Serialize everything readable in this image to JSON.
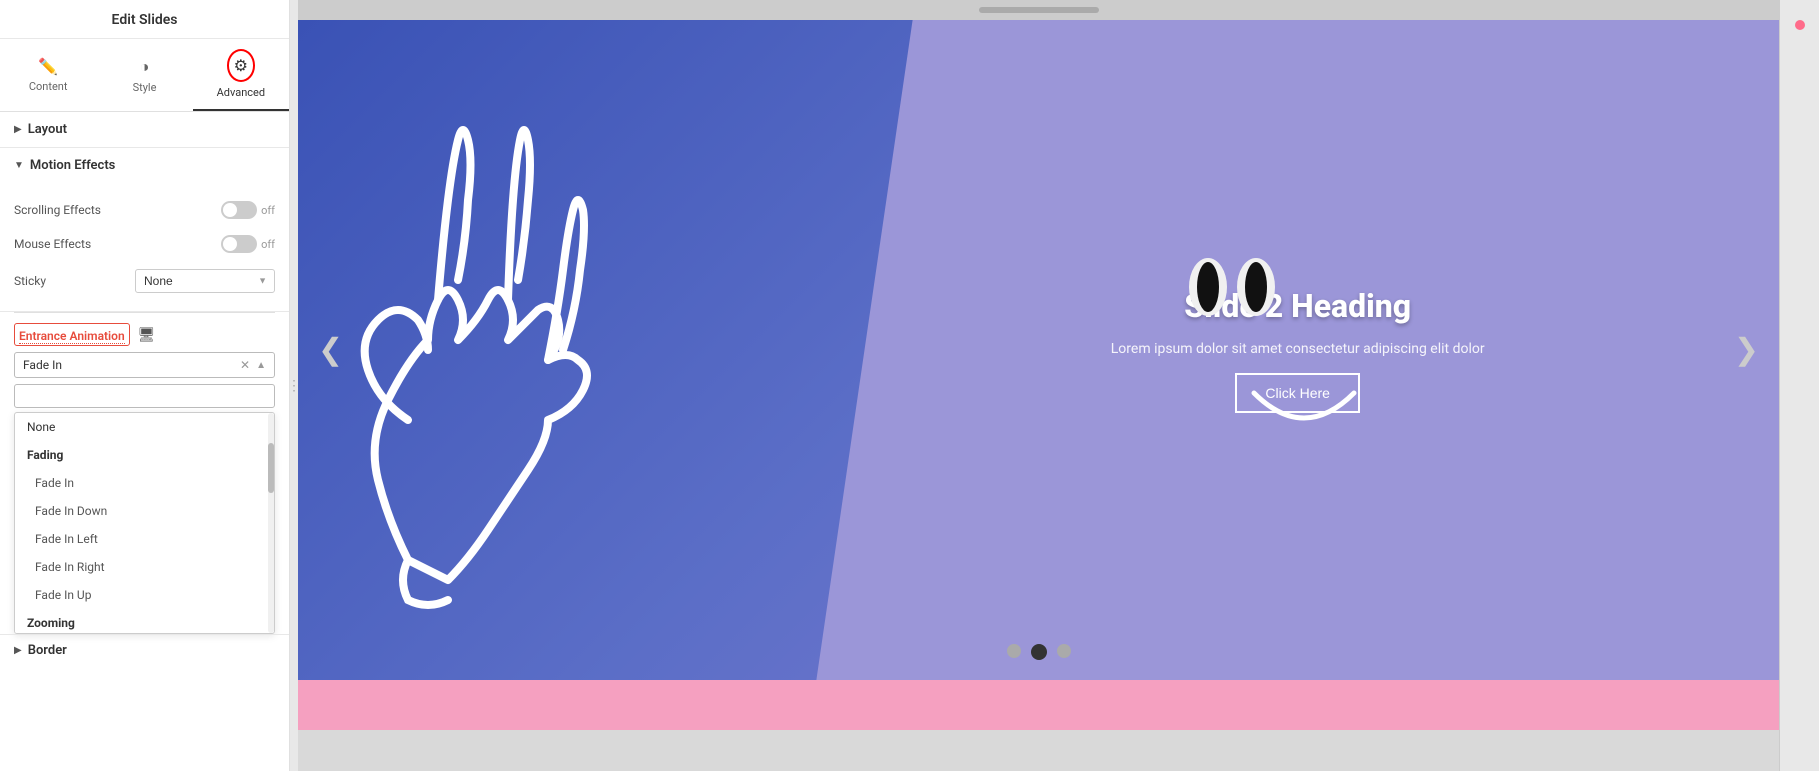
{
  "panel": {
    "title": "Edit Slides",
    "tabs": [
      {
        "id": "content",
        "label": "Content",
        "icon": "✏️"
      },
      {
        "id": "style",
        "label": "Style",
        "icon": "◑"
      },
      {
        "id": "advanced",
        "label": "Advanced",
        "icon": "⚙"
      }
    ],
    "active_tab": "advanced"
  },
  "sections": {
    "layout": {
      "title": "Layout",
      "collapsed": true
    },
    "motion_effects": {
      "title": "Motion Effects",
      "expanded": true,
      "scrolling_effects": {
        "label": "Scrolling Effects",
        "value": "off"
      },
      "mouse_effects": {
        "label": "Mouse Effects",
        "value": "off"
      },
      "sticky": {
        "label": "Sticky",
        "value": "None"
      }
    },
    "entrance_animation": {
      "label": "Entrance Animation",
      "current_value": "Fade In",
      "search_placeholder": "",
      "dropdown_open": true,
      "items": [
        {
          "type": "item",
          "value": "None",
          "label": "None"
        },
        {
          "type": "group",
          "label": "Fading",
          "items": [
            {
              "value": "fade-in",
              "label": "Fade In",
              "selected": true
            },
            {
              "value": "fade-in-down",
              "label": "Fade In Down"
            },
            {
              "value": "fade-in-left",
              "label": "Fade In Left"
            },
            {
              "value": "fade-in-right",
              "label": "Fade In Right"
            },
            {
              "value": "fade-in-up",
              "label": "Fade In Up"
            }
          ]
        },
        {
          "type": "group",
          "label": "Zooming",
          "items": []
        }
      ]
    },
    "border": {
      "title": "Border",
      "collapsed": true
    }
  },
  "slider": {
    "heading": "Slide 2 Heading",
    "text": "Lorem ipsum dolor sit amet consectetur adipiscing elit dolor",
    "button_label": "Click Here",
    "dots": [
      {
        "index": 0,
        "active": false
      },
      {
        "index": 1,
        "active": true
      },
      {
        "index": 2,
        "active": false
      }
    ],
    "prev_arrow": "❮",
    "next_arrow": "❯"
  }
}
